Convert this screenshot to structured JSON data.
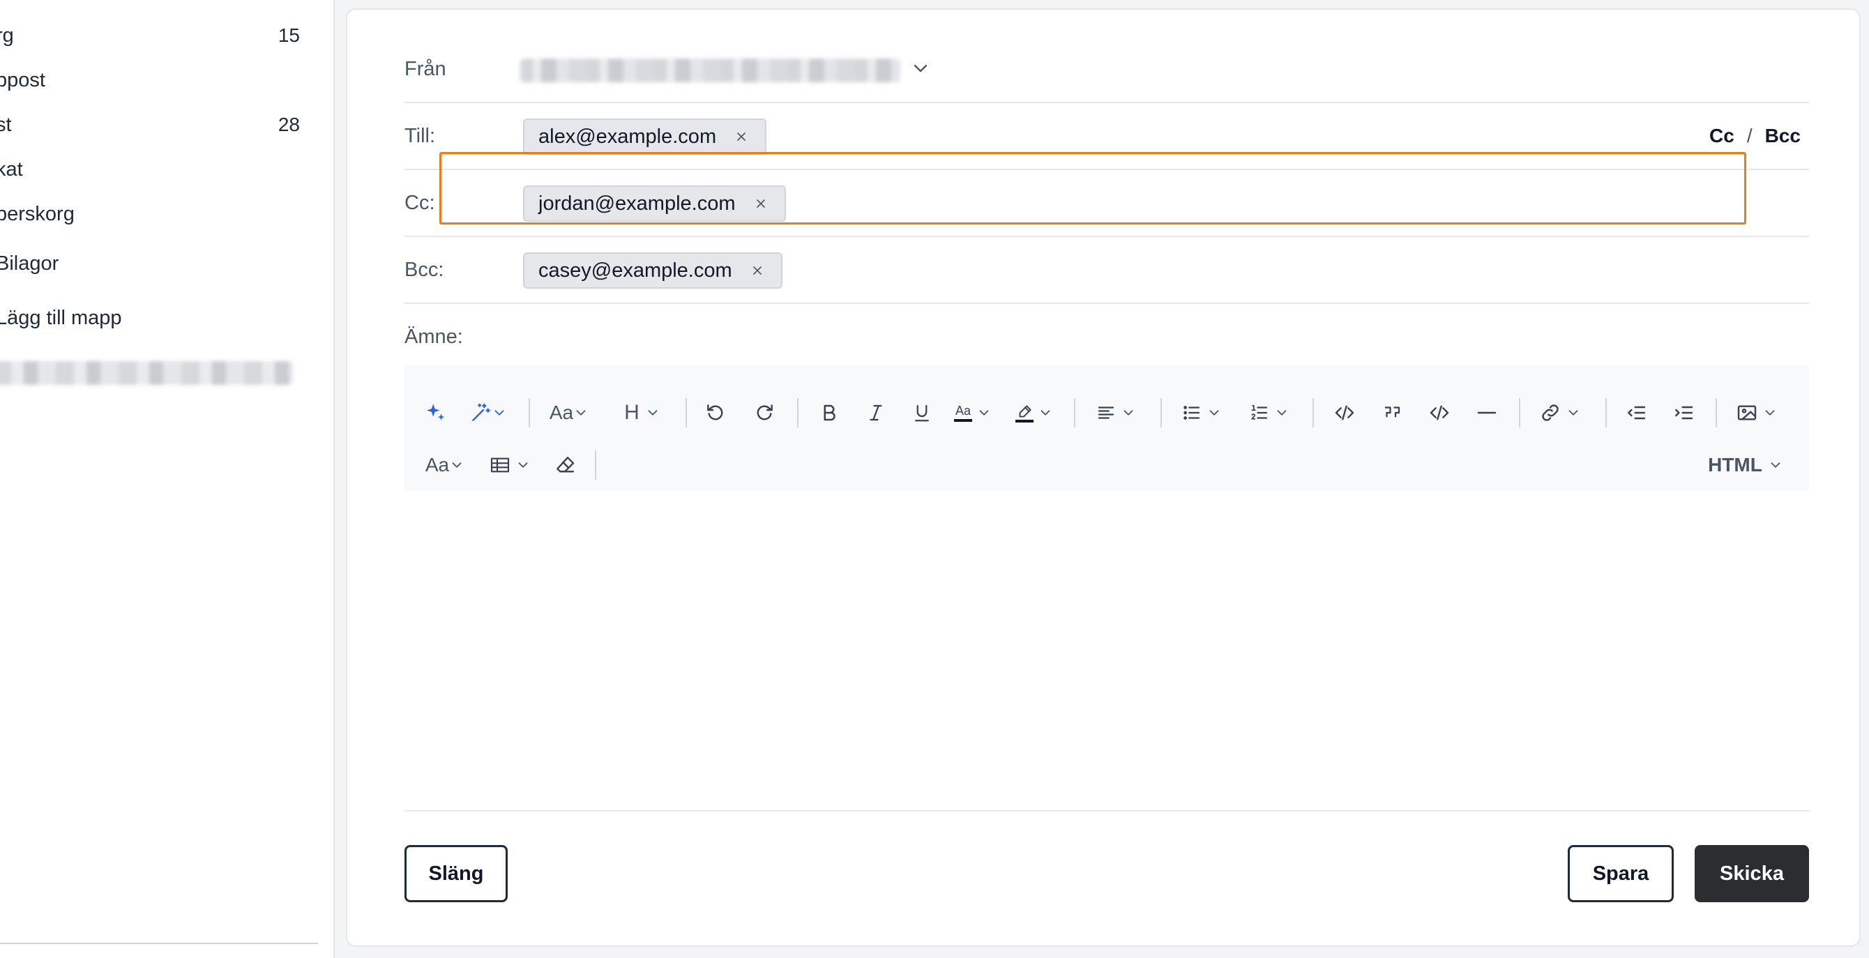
{
  "sidebar": {
    "items": [
      {
        "label": "rg",
        "count": "15"
      },
      {
        "label": "ppost",
        "count": ""
      },
      {
        "label": "st",
        "count": "28"
      },
      {
        "label": "kat",
        "count": ""
      },
      {
        "label": "perskorg",
        "count": ""
      },
      {
        "label": "Bilagor",
        "count": ""
      },
      {
        "label": "Lägg till mapp",
        "count": ""
      }
    ]
  },
  "compose": {
    "from_label": "Från",
    "to_label": "Till:",
    "cc_label": "Cc:",
    "bcc_label": "Bcc:",
    "subject_label": "Ämne:",
    "to_chips": [
      "alex@example.com"
    ],
    "cc_chips": [
      "jordan@example.com"
    ],
    "bcc_chips": [
      "casey@example.com"
    ],
    "cc_link": "Cc",
    "separator": "/",
    "bcc_link": "Bcc"
  },
  "toolbar": {
    "font_size_label": "Aa",
    "heading_label": "H",
    "text_color_label": "Aa",
    "font_family_label": "Aa",
    "format_mode": "HTML"
  },
  "footer": {
    "discard_label": "Släng",
    "save_label": "Spara",
    "send_label": "Skicka"
  },
  "colors": {
    "focus_border": "#f07a1a",
    "ai_icon": "#2563eb",
    "send_button": "#2b2d31"
  }
}
